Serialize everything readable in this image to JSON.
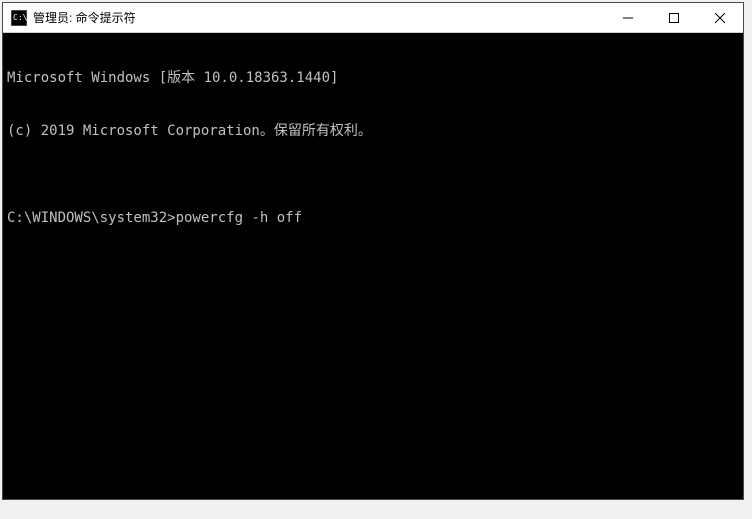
{
  "window": {
    "title": "管理员: 命令提示符"
  },
  "terminal": {
    "lines": [
      "Microsoft Windows [版本 10.0.18363.1440]",
      "(c) 2019 Microsoft Corporation。保留所有权利。",
      "",
      "C:\\WINDOWS\\system32>powercfg -h off",
      ""
    ]
  }
}
